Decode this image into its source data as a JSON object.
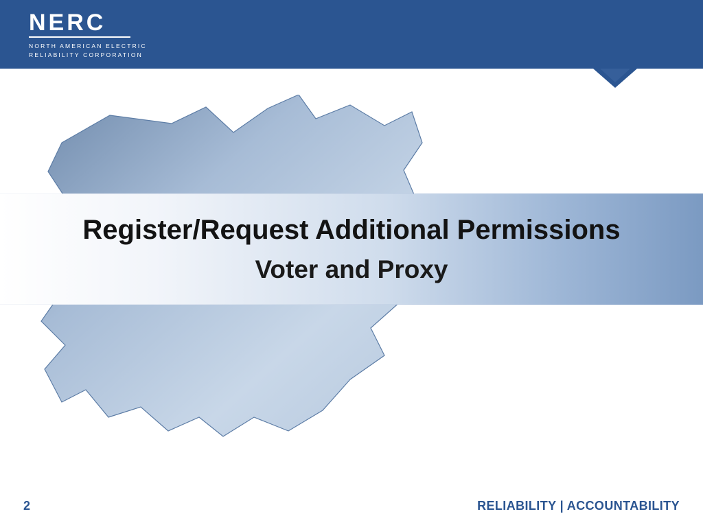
{
  "header": {
    "logo": "NERC",
    "org_line1": "NORTH AMERICAN ELECTRIC",
    "org_line2": "RELIABILITY CORPORATION"
  },
  "title": {
    "line1": "Register/Request Additional Permissions",
    "line2": "Voter and Proxy"
  },
  "footer": {
    "page": "2",
    "tagline": "RELIABILITY | ACCOUNTABILITY"
  },
  "colors": {
    "brand_blue": "#2b5591"
  }
}
